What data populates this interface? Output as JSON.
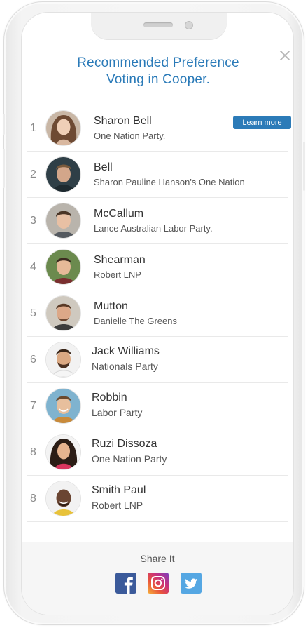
{
  "modal": {
    "title_line1": "Recommended Preference",
    "title_line2": "Voting in Cooper."
  },
  "candidates": [
    {
      "rank": "1",
      "name": "Sharon Bell",
      "party": "One Nation Party.",
      "action": "Learn more"
    },
    {
      "rank": "2",
      "name": "Bell",
      "party": "Sharon Pauline Hanson's One Nation"
    },
    {
      "rank": "3",
      "name": "McCallum",
      "party": "Lance Australian Labor Party."
    },
    {
      "rank": "4",
      "name": "Shearman",
      "party": "Robert LNP"
    },
    {
      "rank": "5",
      "name": "Mutton",
      "party": "Danielle The Greens"
    },
    {
      "rank": "6",
      "name": "Jack Williams",
      "party": "Nationals Party"
    },
    {
      "rank": "7",
      "name": "Robbin",
      "party": "Labor Party"
    },
    {
      "rank": "8",
      "name": "Ruzi Dissoza",
      "party": "One Nation Party"
    },
    {
      "rank": "8",
      "name": "Smith Paul",
      "party": "Robert LNP"
    }
  ],
  "share": {
    "label": "Share It",
    "icons": [
      "facebook-icon",
      "instagram-icon",
      "twitter-icon"
    ]
  },
  "colors": {
    "accent": "#2c7bb8",
    "title": "#2a7ab8",
    "facebook": "#3b5a9a",
    "twitter": "#55a7e3"
  }
}
